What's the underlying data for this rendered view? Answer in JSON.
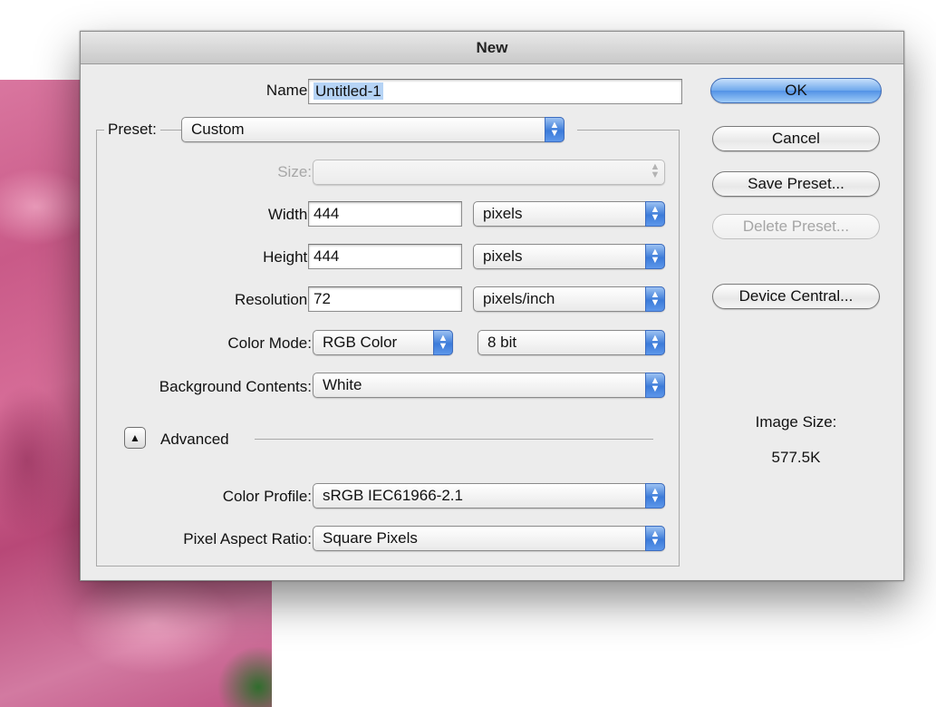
{
  "dialog": {
    "title": "New"
  },
  "name": {
    "label": "Name:",
    "value": "Untitled-1"
  },
  "preset": {
    "label": "Preset:",
    "value": "Custom"
  },
  "size": {
    "label": "Size:",
    "value": ""
  },
  "width": {
    "label": "Width:",
    "value": "444",
    "unit": "pixels"
  },
  "height": {
    "label": "Height:",
    "value": "444",
    "unit": "pixels"
  },
  "resolution": {
    "label": "Resolution:",
    "value": "72",
    "unit": "pixels/inch"
  },
  "color_mode": {
    "label": "Color Mode:",
    "value": "RGB Color",
    "depth": "8 bit"
  },
  "background_contents": {
    "label": "Background Contents:",
    "value": "White"
  },
  "advanced": {
    "label": "Advanced",
    "toggle_icon": "triangle-up"
  },
  "color_profile": {
    "label": "Color Profile:",
    "value": "sRGB IEC61966-2.1"
  },
  "pixel_aspect_ratio": {
    "label": "Pixel Aspect Ratio:",
    "value": "Square Pixels"
  },
  "buttons": {
    "ok": "OK",
    "cancel": "Cancel",
    "save_preset": "Save Preset...",
    "delete_preset": "Delete Preset...",
    "device_central": "Device Central..."
  },
  "image_size": {
    "label": "Image Size:",
    "value": "577.5K"
  },
  "colors": {
    "accent": "#5292e6",
    "selection": "#b5d3f5",
    "dialog_bg": "#ececec"
  }
}
